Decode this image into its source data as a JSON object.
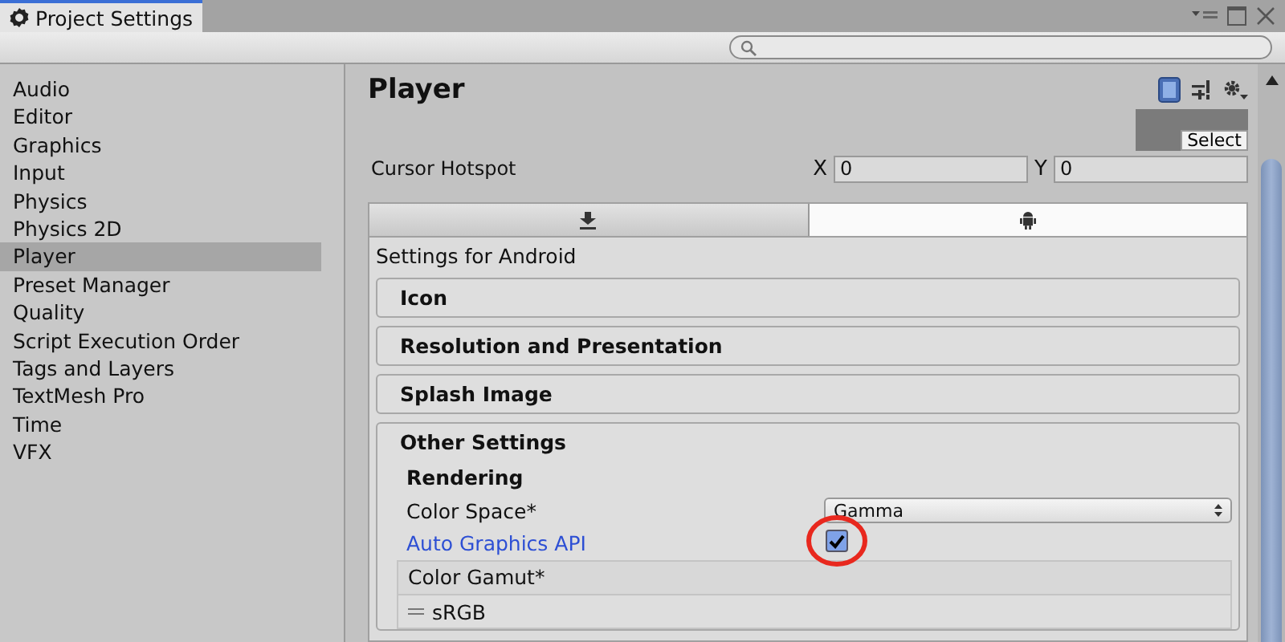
{
  "window": {
    "title": "Project Settings"
  },
  "sidebar": {
    "items": [
      {
        "label": "Audio",
        "selected": false
      },
      {
        "label": "Editor",
        "selected": false
      },
      {
        "label": "Graphics",
        "selected": false
      },
      {
        "label": "Input",
        "selected": false
      },
      {
        "label": "Physics",
        "selected": false
      },
      {
        "label": "Physics 2D",
        "selected": false
      },
      {
        "label": "Player",
        "selected": true
      },
      {
        "label": "Preset Manager",
        "selected": false
      },
      {
        "label": "Quality",
        "selected": false
      },
      {
        "label": "Script Execution Order",
        "selected": false
      },
      {
        "label": "Tags and Layers",
        "selected": false
      },
      {
        "label": "TextMesh Pro",
        "selected": false
      },
      {
        "label": "Time",
        "selected": false
      },
      {
        "label": "VFX",
        "selected": false
      }
    ]
  },
  "panel": {
    "title": "Player",
    "select_button": "Select",
    "cursor_hotspot": {
      "label": "Cursor Hotspot",
      "x_label": "X",
      "x_value": "0",
      "y_label": "Y",
      "y_value": "0"
    },
    "platform_tabs": [
      {
        "kind": "download",
        "selected": false
      },
      {
        "kind": "android",
        "selected": true
      }
    ],
    "platform_heading": "Settings for Android",
    "sections": [
      {
        "title": "Icon",
        "expanded": false
      },
      {
        "title": "Resolution and Presentation",
        "expanded": false
      },
      {
        "title": "Splash Image",
        "expanded": false
      },
      {
        "title": "Other Settings",
        "expanded": true
      }
    ],
    "rendering": {
      "heading": "Rendering",
      "color_space": {
        "label": "Color Space*",
        "value": "Gamma"
      },
      "auto_graphics": {
        "label": "Auto Graphics API",
        "checked": true
      },
      "color_gamut": {
        "label": "Color Gamut*",
        "items": [
          "sRGB"
        ]
      }
    }
  }
}
